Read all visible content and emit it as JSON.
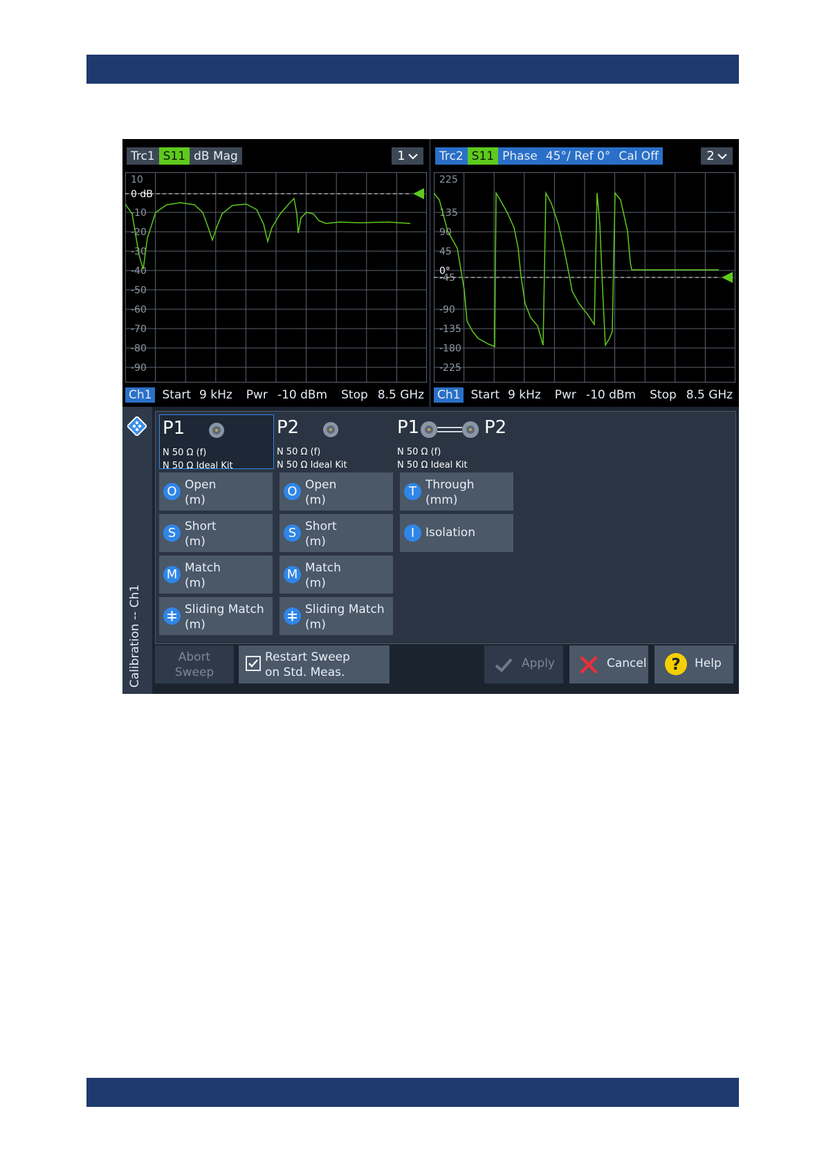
{
  "colors": {
    "band": "#1f3a6e",
    "trace": "#5fc91e",
    "accent_blue": "#2a70c8",
    "button": "#4a5868",
    "panel": "#1b232e"
  },
  "diagram1": {
    "trace_name": "Trc1",
    "parameter": "S11",
    "format": "dB Mag",
    "selector": "1",
    "y_ticks": [
      "10",
      "0 dB",
      "-10",
      "-20",
      "-30",
      "-40",
      "-50",
      "-60",
      "-70",
      "-80",
      "-90"
    ],
    "channel": {
      "ch": "Ch1",
      "start_label": "Start",
      "start_value": "9 kHz",
      "pwr_label": "Pwr",
      "pwr_value": "-10 dBm",
      "stop_label": "Stop",
      "stop_value": "8.5 GHz"
    }
  },
  "diagram2": {
    "trace_name": "Trc2",
    "parameter": "S11",
    "format": "Phase",
    "scale": "45°/ Ref 0°",
    "cal_state": "Cal Off",
    "selector": "2",
    "y_ticks": [
      "225",
      "135",
      "90",
      "45",
      "0°",
      "-45",
      "-90",
      "-135",
      "-180",
      "-225"
    ],
    "channel": {
      "ch": "Ch1",
      "start_label": "Start",
      "start_value": "9 kHz",
      "pwr_label": "Pwr",
      "pwr_value": "-10 dBm",
      "stop_label": "Stop",
      "stop_value": "8.5 GHz"
    }
  },
  "calibration": {
    "title": "Calibration -- Ch1",
    "ports": [
      {
        "label": "P1",
        "connector": "N 50 Ω (f)",
        "kit": "N 50 Ω Ideal Kit"
      },
      {
        "label": "P2",
        "connector": "N 50 Ω (f)",
        "kit": "N 50 Ω Ideal Kit"
      },
      {
        "label_a": "P1",
        "label_b": "P2",
        "connector": "N 50 Ω (f)",
        "kit": "N 50 Ω Ideal Kit"
      }
    ],
    "p1_standards": [
      {
        "letter": "O",
        "name": "Open",
        "gender": "(m)"
      },
      {
        "letter": "S",
        "name": "Short",
        "gender": "(m)"
      },
      {
        "letter": "M",
        "name": "Match",
        "gender": "(m)"
      },
      {
        "letter": "",
        "name": "Sliding Match",
        "gender": "(m)"
      }
    ],
    "p2_standards": [
      {
        "letter": "O",
        "name": "Open",
        "gender": "(m)"
      },
      {
        "letter": "S",
        "name": "Short",
        "gender": "(m)"
      },
      {
        "letter": "M",
        "name": "Match",
        "gender": "(m)"
      },
      {
        "letter": "",
        "name": "Sliding Match",
        "gender": "(m)"
      }
    ],
    "two_port_standards": [
      {
        "letter": "T",
        "name": "Through",
        "gender": "(mm)"
      },
      {
        "letter": "I",
        "name": "Isolation",
        "gender": ""
      }
    ],
    "abort": {
      "line1": "Abort",
      "line2": "Sweep"
    },
    "restart": {
      "line1": "Restart Sweep",
      "line2": "on Std. Meas.",
      "checked": true
    },
    "apply": "Apply",
    "cancel": "Cancel",
    "help": "Help"
  }
}
